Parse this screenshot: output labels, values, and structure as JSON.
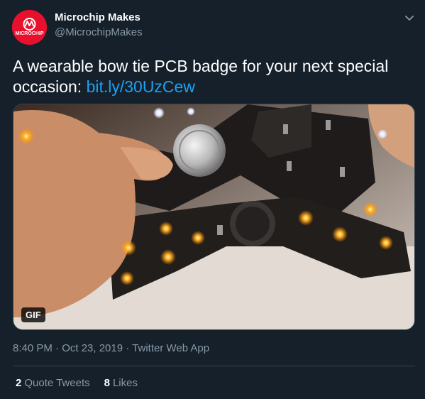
{
  "author": {
    "display_name": "Microchip Makes",
    "handle": "@MicrochipMakes",
    "logo_text": "MICROCHIP",
    "avatar_color": "#e8112d"
  },
  "tweet": {
    "text": "A wearable bow tie PCB badge for your next special occasion: ",
    "link": "bit.ly/30UzCew",
    "media_badge": "GIF",
    "timestamp": "8:40 PM · Oct 23, 2019",
    "separator": " · ",
    "source": "Twitter Web App"
  },
  "stats": {
    "quote_tweets_count": "2",
    "quote_tweets_label": "Quote Tweets",
    "likes_count": "8",
    "likes_label": "Likes"
  },
  "icons": {
    "menu": "chevron-down-icon",
    "avatar": "microchip-logo-icon"
  },
  "colors": {
    "background": "#15202b",
    "link": "#1da1f2",
    "secondary_text": "#8899a6",
    "border": "#38444d"
  }
}
